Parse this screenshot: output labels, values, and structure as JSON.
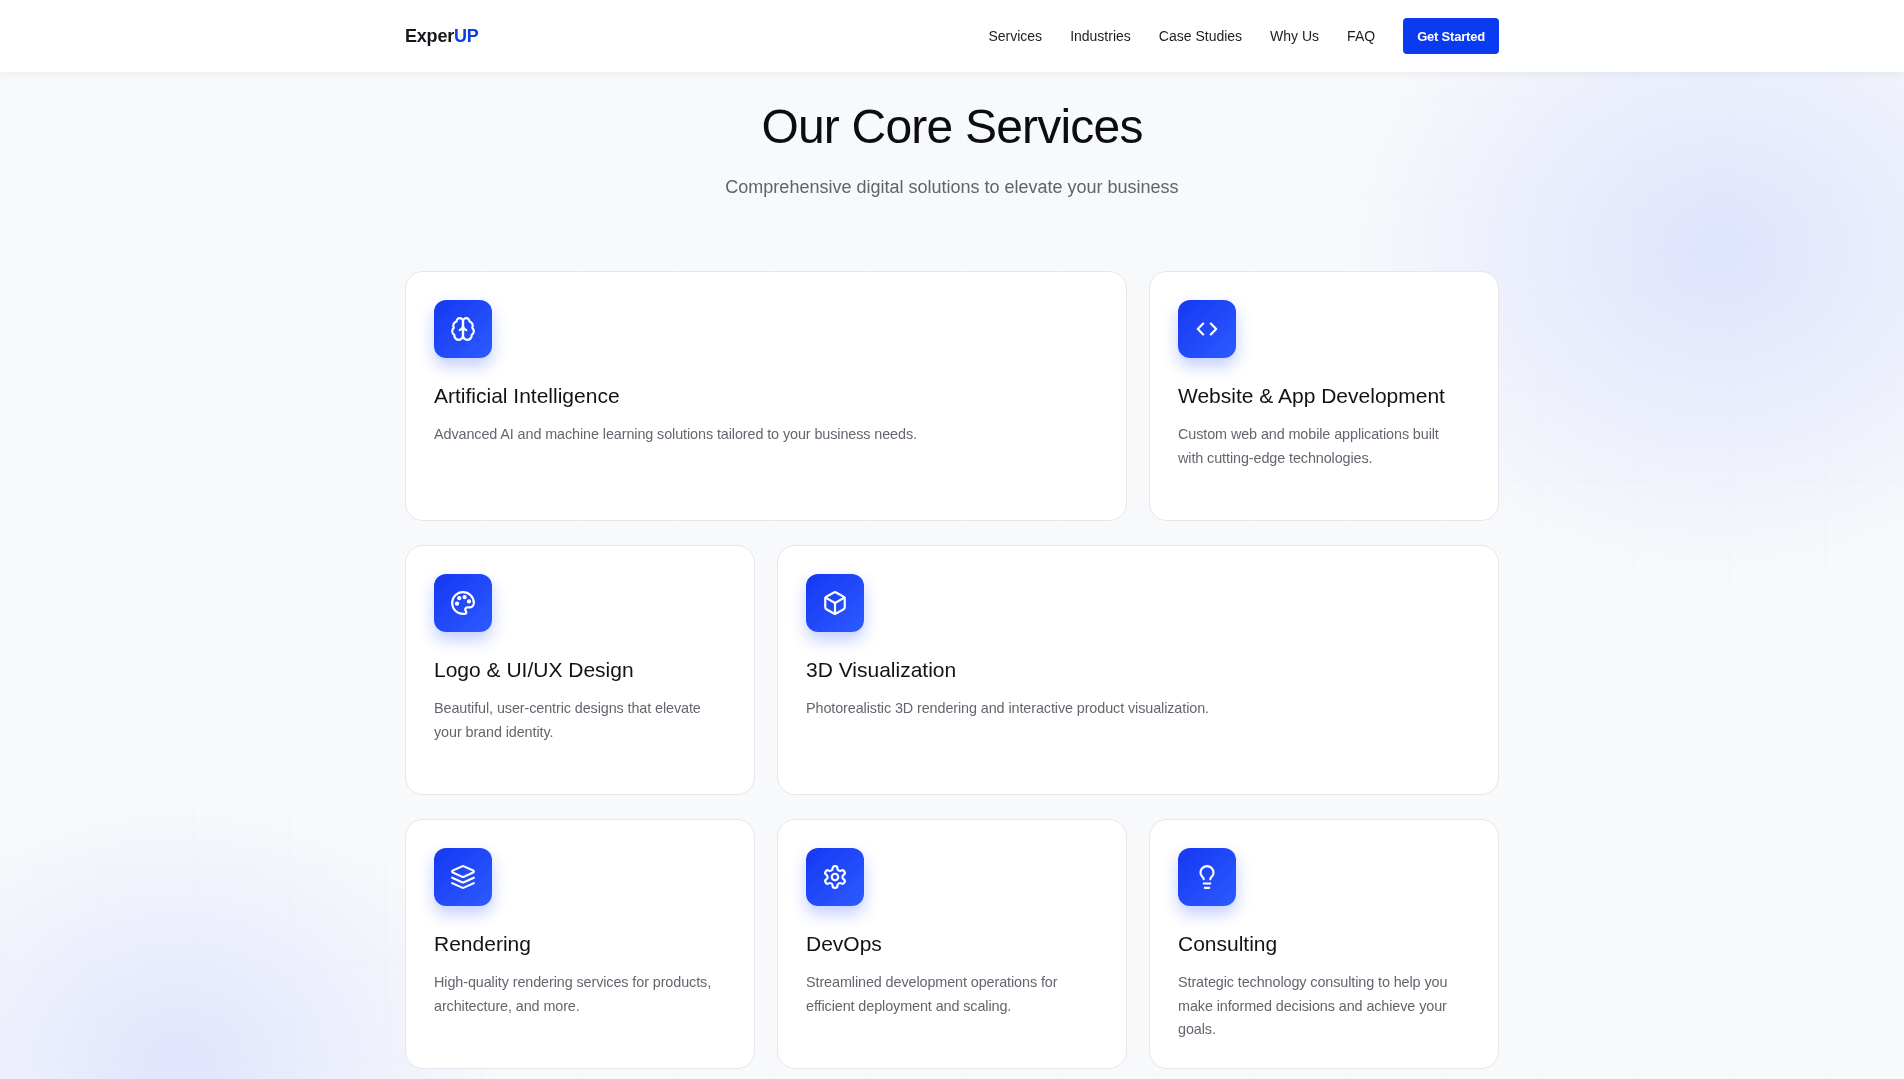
{
  "header": {
    "logo": {
      "text": "Exper",
      "accent": "UP"
    },
    "nav": [
      "Services",
      "Industries",
      "Case Studies",
      "Why Us",
      "FAQ"
    ],
    "cta": "Get Started"
  },
  "hero": {
    "title": "Our Core Services",
    "subtitle": "Comprehensive digital solutions to elevate your business"
  },
  "services": [
    {
      "title": "Artificial Intelligence",
      "description": "Advanced AI and machine learning solutions tailored to your business needs."
    },
    {
      "title": "Website & App Development",
      "description": "Custom web and mobile applications built with cutting-edge technologies."
    },
    {
      "title": "Logo & UI/UX Design",
      "description": "Beautiful, user-centric designs that elevate your brand identity."
    },
    {
      "title": "3D Visualization",
      "description": "Photorealistic 3D rendering and interactive product visualization."
    },
    {
      "title": "Rendering",
      "description": "High-quality rendering services for products, architecture, and more."
    },
    {
      "title": "DevOps",
      "description": "Streamlined development operations for efficient deployment and scaling."
    },
    {
      "title": "Consulting",
      "description": "Strategic technology consulting to help you make informed decisions and achieve your goals."
    }
  ]
}
